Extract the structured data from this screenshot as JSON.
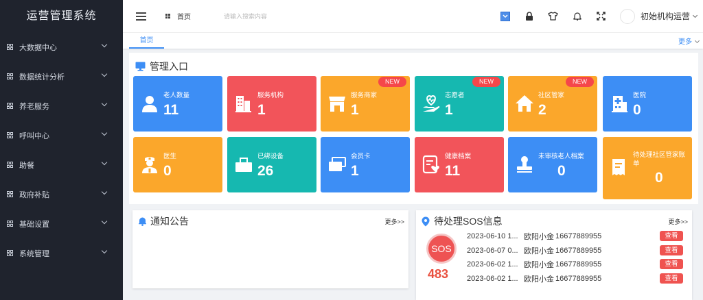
{
  "app_title": "运营管理系统",
  "sidebar": {
    "items": [
      {
        "label": "大数据中心"
      },
      {
        "label": "数据统计分析"
      },
      {
        "label": "养老服务"
      },
      {
        "label": "呼叫中心"
      },
      {
        "label": "助餐"
      },
      {
        "label": "政府补贴"
      },
      {
        "label": "基础设置"
      },
      {
        "label": "系统管理"
      }
    ]
  },
  "header": {
    "home_label": "首页",
    "search_placeholder": "请输入搜索内容",
    "user_name": "初始机构运营"
  },
  "tabs": {
    "home": "首页",
    "more": "更多"
  },
  "management": {
    "title": "管理入口",
    "cards": [
      {
        "label": "老人数量",
        "value": "11",
        "color": "#3d8ef5"
      },
      {
        "label": "服务机构",
        "value": "1",
        "color": "#f2545a"
      },
      {
        "label": "服务商家",
        "value": "1",
        "color": "#fba72b",
        "badge": "NEW"
      },
      {
        "label": "志愿者",
        "value": "1",
        "color": "#16b8b0",
        "badge": "NEW"
      },
      {
        "label": "社区管家",
        "value": "2",
        "color": "#fba72b",
        "badge": "NEW"
      },
      {
        "label": "医院",
        "value": "0",
        "color": "#3d8ef5"
      },
      {
        "label": "医生",
        "value": "0",
        "color": "#fba72b"
      },
      {
        "label": "已绑设备",
        "value": "26",
        "color": "#16b8b0"
      },
      {
        "label": "会员卡",
        "value": "1",
        "color": "#3d8ef5"
      },
      {
        "label": "健康档案",
        "value": "11",
        "color": "#f2545a"
      },
      {
        "label": "未审核老人档案",
        "value": "0",
        "color": "#3d8ef5"
      },
      {
        "label": "待处理社区管家账单",
        "value": "0",
        "color": "#fba72b"
      }
    ]
  },
  "notice": {
    "title": "通知公告",
    "more": "更多>>"
  },
  "sos": {
    "title": "待处理SOS信息",
    "more": "更多>>",
    "badge": "SOS",
    "count": "483",
    "rows": [
      {
        "date": "2023-06-10 1...",
        "name": "欧阳小金",
        "phone": "16677889955",
        "action": "查看"
      },
      {
        "date": "2023-06-07 0...",
        "name": "欧阳小金",
        "phone": "16677889955",
        "action": "查看"
      },
      {
        "date": "2023-06-02 1...",
        "name": "欧阳小金",
        "phone": "16677889955",
        "action": "查看"
      },
      {
        "date": "2023-06-02 1...",
        "name": "欧阳小金",
        "phone": "16677889955",
        "action": "查看"
      }
    ]
  }
}
